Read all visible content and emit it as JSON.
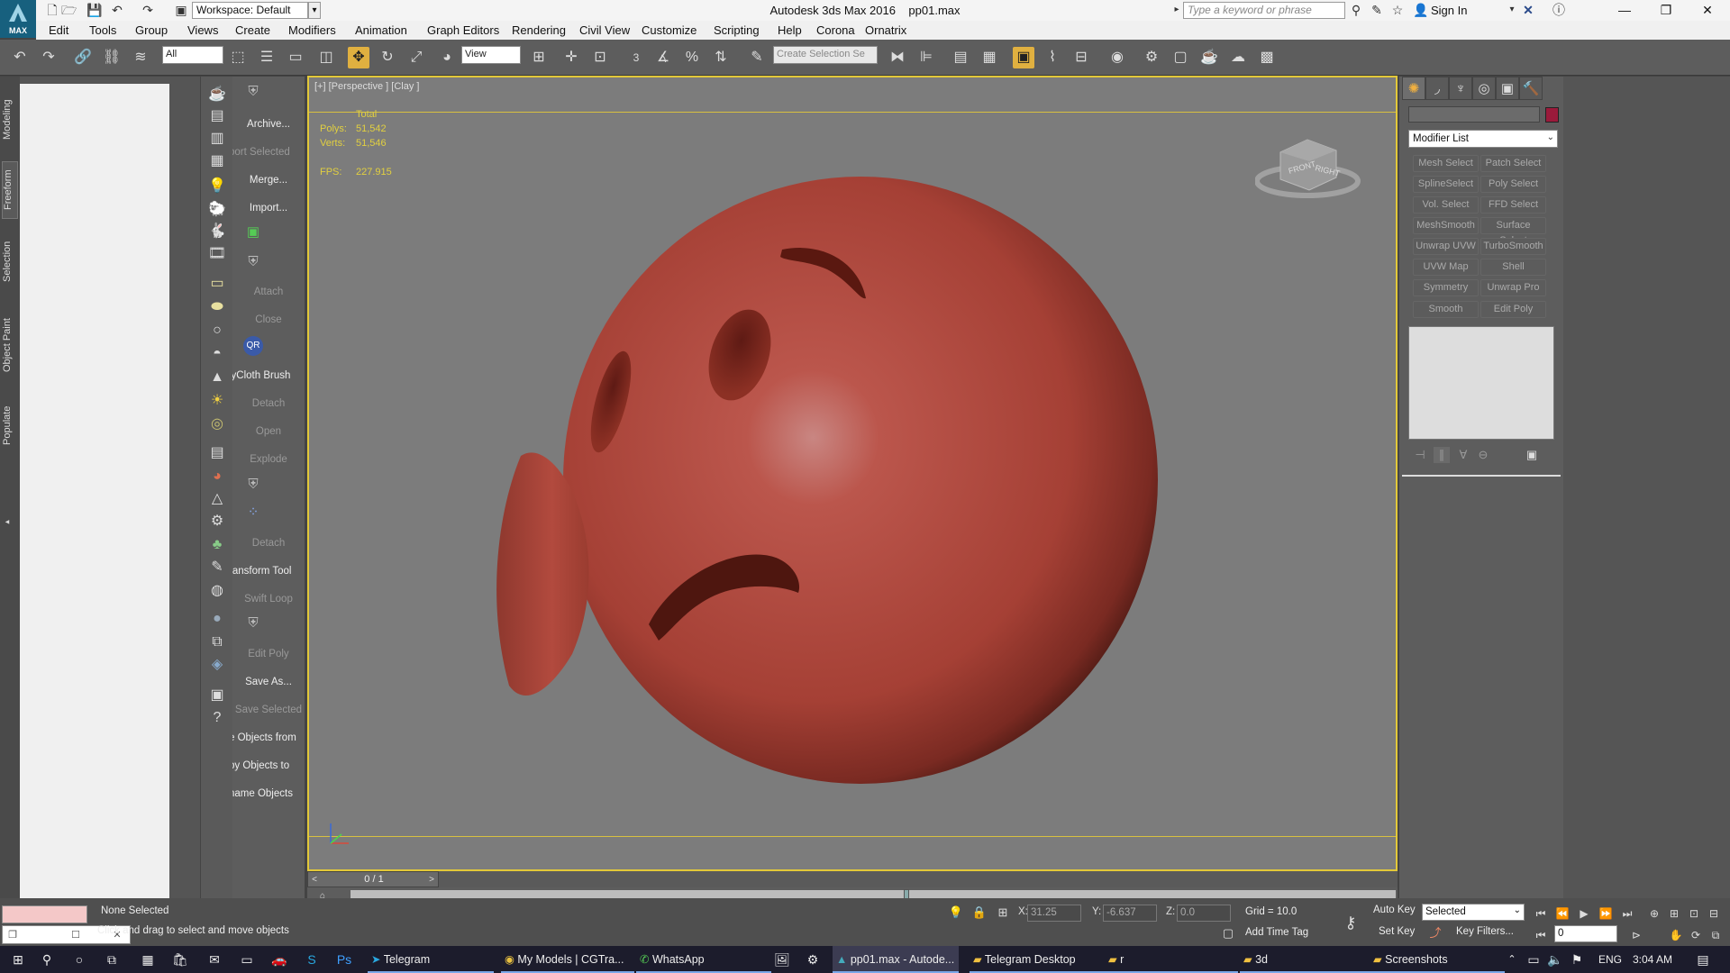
{
  "titlebar": {
    "workspace": "Workspace: Default",
    "app_title": "Autodesk 3ds Max 2016",
    "file_name": "pp01.max",
    "search_placeholder": "Type a keyword or phrase",
    "sign_in": "Sign In",
    "logo_text": "MAX"
  },
  "menu": [
    "Edit",
    "Tools",
    "Group",
    "Views",
    "Create",
    "Modifiers",
    "Animation",
    "Graph Editors",
    "Rendering",
    "Civil View",
    "Customize",
    "Scripting",
    "Help",
    "Corona",
    "Ornatrix"
  ],
  "toolbar": {
    "filter_value": "All",
    "ref_coord": "View",
    "selection_set_placeholder": "Create Selection Se",
    "snap_label": "3"
  },
  "ribbon_tabs": [
    "Modeling",
    "Freeform",
    "Selection",
    "Object Paint",
    "Populate"
  ],
  "cmd_items": [
    {
      "label": "Archive...",
      "dim": false
    },
    {
      "label": "port Selected",
      "dim": true
    },
    {
      "label": "Merge...",
      "dim": false
    },
    {
      "label": "Import...",
      "dim": false
    },
    {
      "label": "Attach",
      "dim": true
    },
    {
      "label": "Close",
      "dim": true
    },
    {
      "label": "lyCloth Brush",
      "dim": false
    },
    {
      "label": "Detach",
      "dim": true
    },
    {
      "label": "Open",
      "dim": true
    },
    {
      "label": "Explode",
      "dim": true
    },
    {
      "label": "Detach",
      "dim": true
    },
    {
      "label": "ransform Tool",
      "dim": false
    },
    {
      "label": "Swift Loop",
      "dim": true
    },
    {
      "label": "Edit Poly",
      "dim": true
    },
    {
      "label": "Save As...",
      "dim": false
    },
    {
      "label": "Save Selected",
      "dim": true
    },
    {
      "label": "e Objects from",
      "dim": false
    },
    {
      "label": "by Objects to",
      "dim": false
    },
    {
      "label": "name Objects",
      "dim": false
    }
  ],
  "viewport": {
    "label": "[+] [Perspective ] [Clay ]",
    "stats_header": "Total",
    "polys_label": "Polys:",
    "polys_value": "51,542",
    "verts_label": "Verts:",
    "verts_value": "51,546",
    "fps_label": "FPS:",
    "fps_value": "227.915",
    "viewcube_front": "FRONT",
    "viewcube_right": "RIGHT",
    "model_color": "#b84a3e"
  },
  "timeline": {
    "frame_label": "0 / 1"
  },
  "command_panel": {
    "modifier_list": "Modifier List",
    "object_color": "#9b1a3b",
    "buttons": [
      "Mesh Select",
      "Patch Select",
      "SplineSelect",
      "Poly Select",
      "Vol. Select",
      "FFD Select",
      "MeshSmooth",
      "Surface Select",
      "Unwrap UVW",
      "TurboSmooth",
      "UVW Map",
      "Shell",
      "Symmetry",
      "Unwrap Pro",
      "Smooth",
      "Edit Poly"
    ]
  },
  "status": {
    "selection": "None Selected",
    "prompt": "Click and drag to select and move objects",
    "x_label": "X:",
    "x_value": "31.25",
    "y_label": "Y:",
    "y_value": "-6.637",
    "z_label": "Z:",
    "z_value": "0.0",
    "grid": "Grid = 10.0",
    "add_time_tag": "Add Time Tag",
    "auto_key": "Auto Key",
    "set_key": "Set Key",
    "selected_combo": "Selected",
    "key_filters": "Key Filters...",
    "frame_value": "0"
  },
  "taskbar": {
    "items": [
      "Telegram",
      "My Models | CGTra...",
      "WhatsApp",
      "pp01.max - Autode...",
      "Telegram Desktop",
      "r",
      "3d",
      "Screenshots"
    ],
    "lang": "ENG",
    "time": "3:04 AM"
  },
  "accent_colors": {
    "viewport_border": "#e2c839",
    "active_tool": "#e0b040"
  }
}
